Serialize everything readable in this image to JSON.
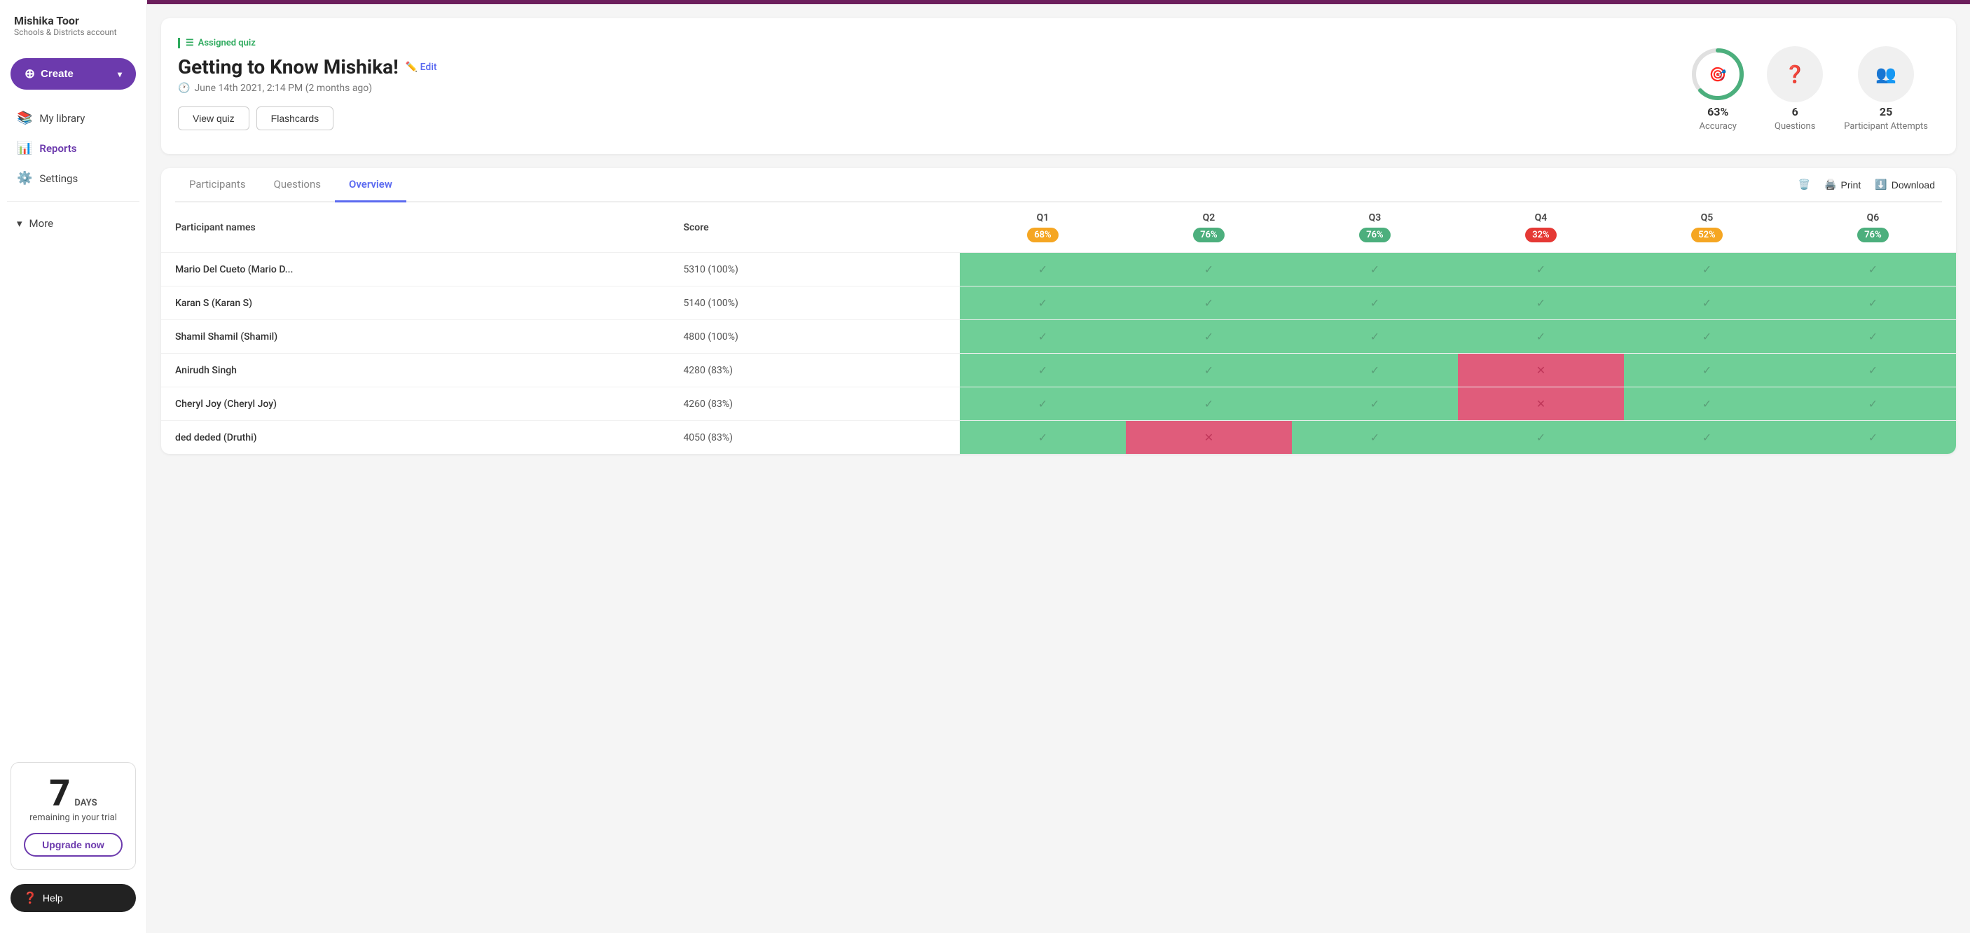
{
  "sidebar": {
    "user": {
      "name": "Mishika Toor",
      "role": "Schools & Districts account"
    },
    "create_label": "Create",
    "nav_items": [
      {
        "id": "my-library",
        "label": "My library",
        "icon": "📚",
        "active": false
      },
      {
        "id": "reports",
        "label": "Reports",
        "icon": "📊",
        "active": true
      },
      {
        "id": "settings",
        "label": "Settings",
        "icon": "⚙️",
        "active": false
      }
    ],
    "more_label": "More",
    "trial": {
      "days": "7",
      "days_label": "DAYS",
      "remaining_text": "remaining in your trial",
      "upgrade_label": "Upgrade now"
    },
    "help_label": "Help"
  },
  "quiz": {
    "tag": "Assigned quiz",
    "title": "Getting to Know Mishika!",
    "edit_label": "Edit",
    "date": "June 14th 2021, 2:14 PM (2 months ago)",
    "view_quiz_btn": "View quiz",
    "flashcards_btn": "Flashcards",
    "stats": {
      "accuracy": {
        "value": "63%",
        "label": "Accuracy"
      },
      "questions": {
        "value": "6",
        "label": "Questions"
      },
      "attempts": {
        "value": "25",
        "label": "Participant Attempts"
      }
    }
  },
  "tabs": {
    "items": [
      {
        "id": "participants",
        "label": "Participants",
        "active": false
      },
      {
        "id": "questions",
        "label": "Questions",
        "active": false
      },
      {
        "id": "overview",
        "label": "Overview",
        "active": true
      }
    ],
    "actions": {
      "print": "Print",
      "download": "Download"
    }
  },
  "table": {
    "col_participant": "Participant names",
    "col_score": "Score",
    "questions": [
      {
        "id": "Q1",
        "pct": "68%",
        "color": "yellow"
      },
      {
        "id": "Q2",
        "pct": "76%",
        "color": "green"
      },
      {
        "id": "Q3",
        "pct": "76%",
        "color": "green"
      },
      {
        "id": "Q4",
        "pct": "32%",
        "color": "red"
      },
      {
        "id": "Q5",
        "pct": "52%",
        "color": "orange"
      },
      {
        "id": "Q6",
        "pct": "76%",
        "color": "green"
      }
    ],
    "rows": [
      {
        "name": "Mario Del Cueto (Mario D...",
        "score": "5310 (100%)",
        "answers": [
          "correct",
          "correct",
          "correct",
          "correct",
          "correct",
          "correct"
        ]
      },
      {
        "name": "Karan S (Karan S)",
        "score": "5140 (100%)",
        "answers": [
          "correct",
          "correct",
          "correct",
          "correct",
          "correct",
          "correct"
        ]
      },
      {
        "name": "Shamil Shamil (Shamil)",
        "score": "4800 (100%)",
        "answers": [
          "correct",
          "correct",
          "correct",
          "correct",
          "correct",
          "correct"
        ]
      },
      {
        "name": "Anirudh Singh",
        "score": "4280 (83%)",
        "answers": [
          "correct",
          "correct",
          "correct",
          "wrong",
          "correct",
          "correct"
        ]
      },
      {
        "name": "Cheryl Joy (Cheryl Joy)",
        "score": "4260 (83%)",
        "answers": [
          "correct",
          "correct",
          "correct",
          "wrong",
          "correct",
          "correct"
        ]
      },
      {
        "name": "ded deded (Druthi)",
        "score": "4050 (83%)",
        "answers": [
          "correct",
          "wrong",
          "correct",
          "correct",
          "correct",
          "correct"
        ]
      }
    ]
  }
}
